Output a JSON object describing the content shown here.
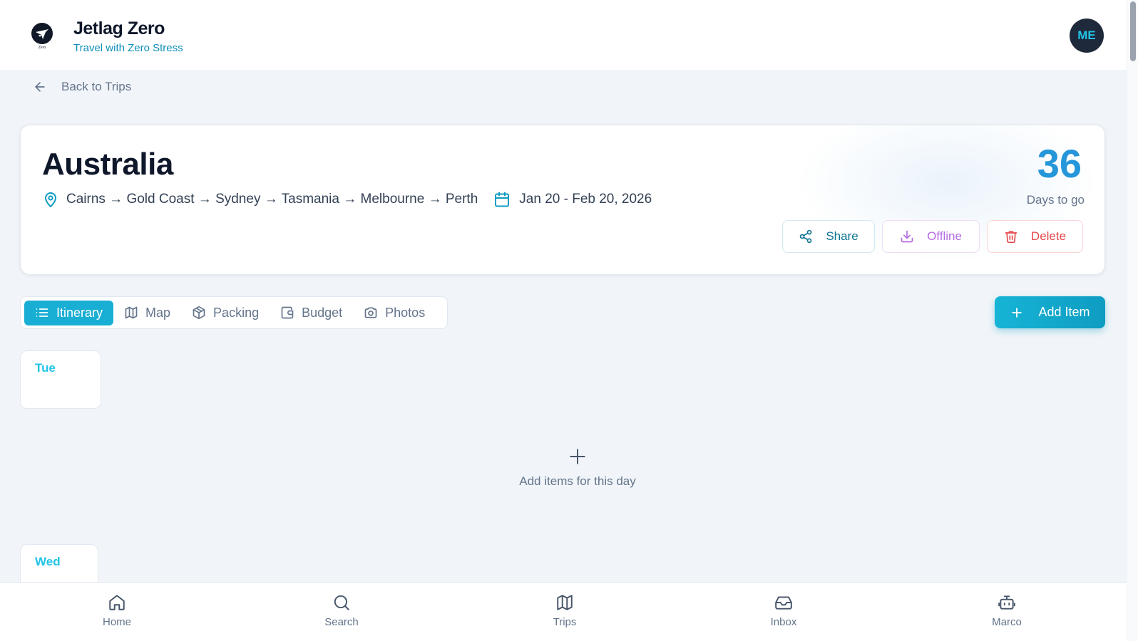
{
  "header": {
    "brand_title": "Jetlag Zero",
    "brand_subtitle": "Travel with Zero Stress",
    "logo_text": "Zero",
    "avatar_initials": "ME"
  },
  "nav": {
    "back_label": "Back to Trips"
  },
  "trip": {
    "title": "Australia",
    "route": "Cairns → Gold Coast → Sydney → Tasmania → Melbourne → Perth",
    "dates": "Jan 20 - Feb 20, 2026",
    "countdown_value": "36",
    "countdown_label": "Days to go",
    "actions": {
      "share": "Share",
      "offline": "Offline",
      "delete": "Delete"
    }
  },
  "tabs": [
    {
      "label": "Itinerary",
      "icon": "list-icon",
      "active": true
    },
    {
      "label": "Map",
      "icon": "map-icon",
      "active": false
    },
    {
      "label": "Packing",
      "icon": "package-icon",
      "active": false
    },
    {
      "label": "Budget",
      "icon": "wallet-icon",
      "active": false
    },
    {
      "label": "Photos",
      "icon": "camera-icon",
      "active": false
    }
  ],
  "add_item_label": "Add Item",
  "days": [
    {
      "label": "Tue"
    },
    {
      "label": "Wed"
    }
  ],
  "empty_day_text": "Add items for this day",
  "bottom_nav": [
    {
      "label": "Home",
      "icon": "home-icon"
    },
    {
      "label": "Search",
      "icon": "search-icon"
    },
    {
      "label": "Trips",
      "icon": "map-icon"
    },
    {
      "label": "Inbox",
      "icon": "inbox-icon"
    },
    {
      "label": "Marco",
      "icon": "bot-icon"
    }
  ],
  "colors": {
    "accent": "#19aed3",
    "countdown": "#2596d9",
    "offline": "#b46ce0",
    "delete": "#e5484d",
    "day_label": "#22c3e6"
  }
}
